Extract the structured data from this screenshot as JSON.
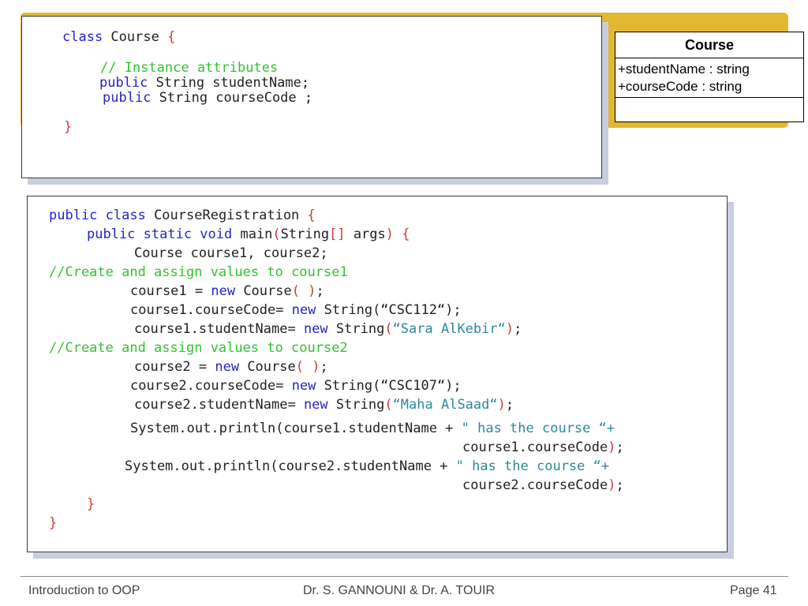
{
  "uml": {
    "class_name": "Course",
    "attributes": [
      "+studentName : string",
      "+courseCode : string"
    ]
  },
  "code1": {
    "l1": {
      "kw": "class",
      "name": " Course ",
      "brace": "{"
    },
    "l2": "// Instance attributes",
    "l3": {
      "kw": "public",
      "rest": " String studentName;"
    },
    "l4": {
      "kw": "public",
      "rest": " String courseCode ;"
    },
    "l5": "}"
  },
  "code2": {
    "l1": {
      "kw": "public class",
      "rest": " CourseRegistration ",
      "brace": "{"
    },
    "l2": {
      "kw": "public static void",
      "a": " main",
      "p1": "(",
      "b": "String",
      "p2": "[]",
      "c": " args",
      "p3": ")",
      "d": " ",
      "p4": "{"
    },
    "l3": "Course course1, course2;",
    "l4": "//Create and assign values to course1",
    "l5": {
      "a": "course1 = ",
      "kw": "new",
      "b": " Course",
      "p": "( )",
      "c": ";"
    },
    "l6": {
      "a": "course1.courseCode= ",
      "kw": "new",
      "b": " String(“CSC112“);"
    },
    "l7": {
      "a": "course1.studentName= ",
      "kw": "new",
      "b": " String",
      "p1": "(",
      "st": "“Sara AlKebir“",
      "p2": ")",
      "c": ";"
    },
    "l8": "//Create and assign values to course2",
    "l9": {
      "a": "course2 = ",
      "kw": "new",
      "b": " Course",
      "p": "( )",
      "c": ";"
    },
    "l10": {
      "a": "course2.courseCode= ",
      "kw": "new",
      "b": " String(“CSC107“);"
    },
    "l11": {
      "a": "course2.studentName= ",
      "kw": "new",
      "b": " String",
      "p1": "(",
      "st": "“Maha AlSaad“",
      "p2": ")",
      "c": ";"
    },
    "l12": {
      "a": "System.out.println(course1.studentName + ",
      "st": "\" has the course “+"
    },
    "l13": {
      "a": "course1.courseCode",
      "p": ")",
      "c": ";"
    },
    "l14": {
      "a": "System.out.println(course2.studentName + ",
      "st": "\" has the course “+"
    },
    "l15": {
      "a": "course2.courseCode",
      "p": ")",
      "c": ";"
    },
    "l16": "}",
    "l17": "}"
  },
  "footer": {
    "left": "Introduction to OOP",
    "center": "Dr. S. GANNOUNI & Dr.  A. TOUIR",
    "right": "Page 41"
  }
}
